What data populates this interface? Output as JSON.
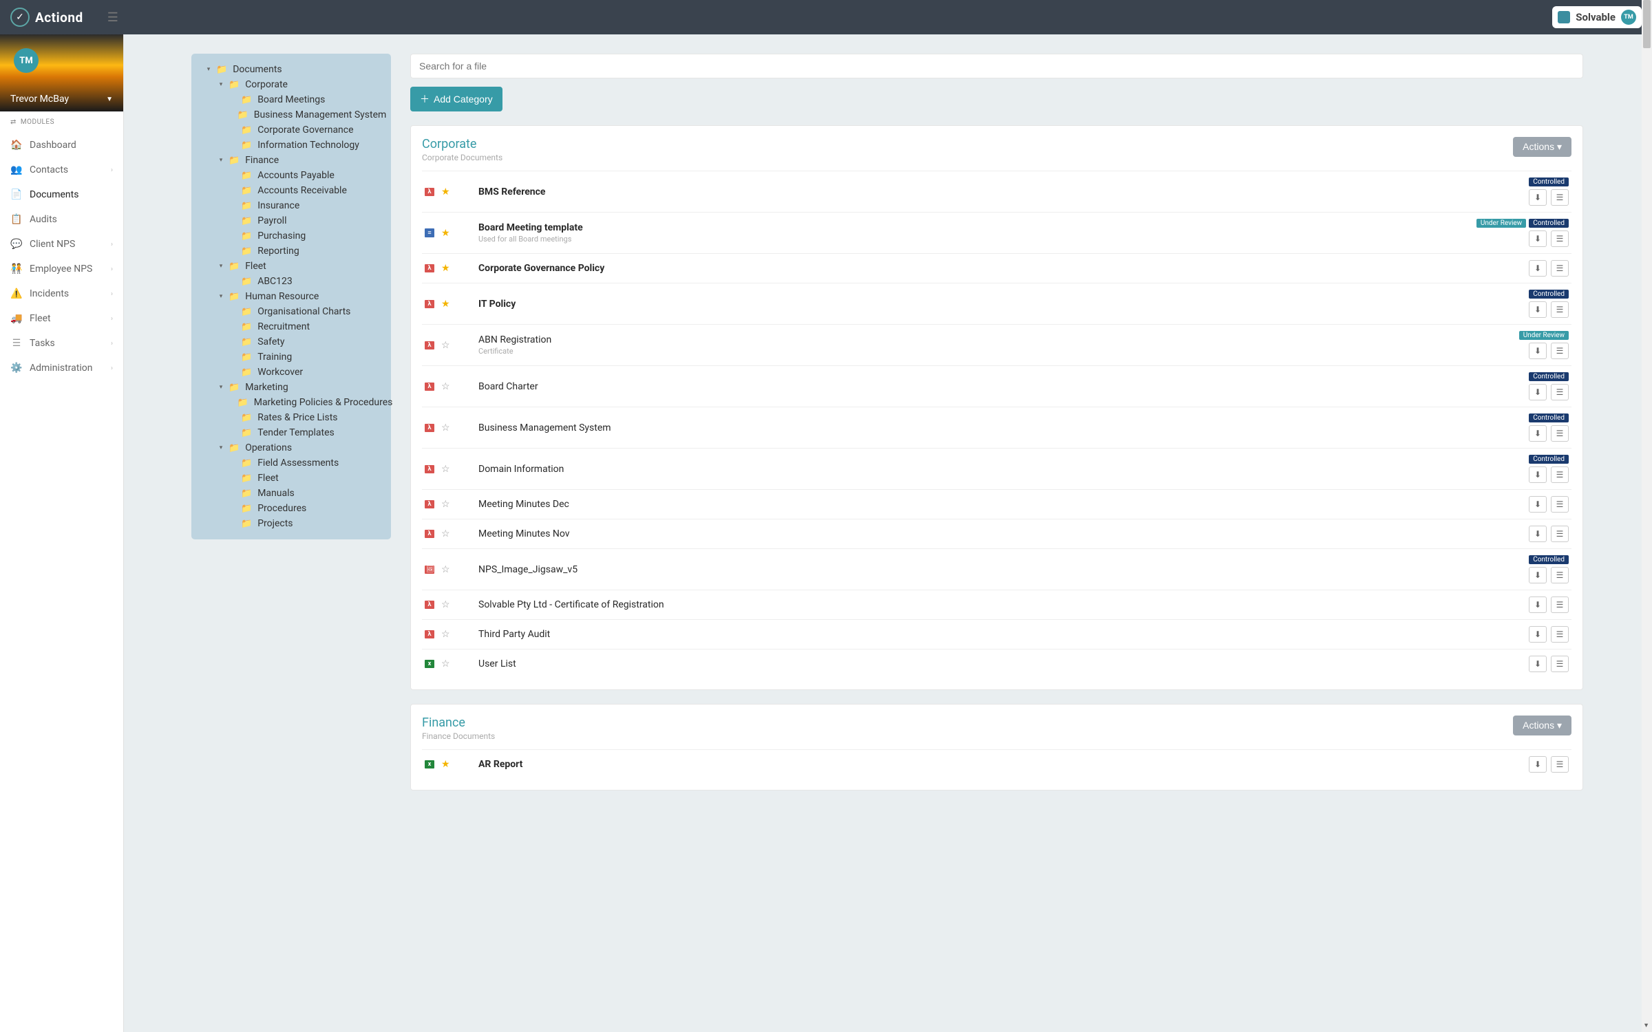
{
  "brand": {
    "name": "Actiond",
    "pill_text": "Solvable",
    "pill_avatar": "TM"
  },
  "user": {
    "initials": "TM",
    "name": "Trevor McBay"
  },
  "sidebar": {
    "modules_label": "MODULES",
    "items": [
      {
        "label": "Dashboard",
        "expandable": false
      },
      {
        "label": "Contacts",
        "expandable": true
      },
      {
        "label": "Documents",
        "expandable": false,
        "active": true
      },
      {
        "label": "Audits",
        "expandable": false
      },
      {
        "label": "Client NPS",
        "expandable": true
      },
      {
        "label": "Employee NPS",
        "expandable": true
      },
      {
        "label": "Incidents",
        "expandable": true
      },
      {
        "label": "Fleet",
        "expandable": true
      },
      {
        "label": "Tasks",
        "expandable": true
      },
      {
        "label": "Administration",
        "expandable": true
      }
    ]
  },
  "tree": {
    "root": "Documents",
    "nodes": [
      {
        "label": "Corporate",
        "children": [
          "Board Meetings",
          "Business Management System",
          "Corporate Governance",
          "Information Technology"
        ]
      },
      {
        "label": "Finance",
        "children": [
          "Accounts Payable",
          "Accounts Receivable",
          "Insurance",
          "Payroll",
          "Purchasing",
          "Reporting"
        ]
      },
      {
        "label": "Fleet",
        "children": [
          "ABC123"
        ]
      },
      {
        "label": "Human Resource",
        "children": [
          "Organisational Charts",
          "Recruitment",
          "Safety",
          "Training",
          "Workcover"
        ]
      },
      {
        "label": "Marketing",
        "children": [
          "Marketing Policies & Procedures",
          "Rates & Price Lists",
          "Tender Templates"
        ]
      },
      {
        "label": "Operations",
        "children": [
          "Field Assessments",
          "Fleet",
          "Manuals",
          "Procedures",
          "Projects"
        ]
      }
    ]
  },
  "search": {
    "placeholder": "Search for a file"
  },
  "buttons": {
    "add_category": "Add Category",
    "actions": "Actions"
  },
  "badges": {
    "controlled": "Controlled",
    "under_review": "Under Review"
  },
  "categories": [
    {
      "title": "Corporate",
      "subtitle": "Corporate Documents",
      "files": [
        {
          "name": "BMS Reference",
          "type": "pdf",
          "starred": true,
          "bold": true,
          "badges": [
            "controlled"
          ]
        },
        {
          "name": "Board Meeting template",
          "type": "doc",
          "starred": true,
          "bold": true,
          "desc": "Used for all Board meetings",
          "badges": [
            "under_review",
            "controlled"
          ]
        },
        {
          "name": "Corporate Governance Policy",
          "type": "pdf",
          "starred": true,
          "bold": true,
          "badges": []
        },
        {
          "name": "IT Policy",
          "type": "pdf",
          "starred": true,
          "bold": true,
          "badges": [
            "controlled"
          ]
        },
        {
          "name": "ABN Registration",
          "type": "pdf",
          "starred": false,
          "bold": false,
          "desc": "Certificate",
          "badges": [
            "under_review"
          ]
        },
        {
          "name": "Board Charter",
          "type": "pdf",
          "starred": false,
          "bold": false,
          "badges": [
            "controlled"
          ]
        },
        {
          "name": "Business Management System",
          "type": "pdf",
          "starred": false,
          "bold": false,
          "badges": [
            "controlled"
          ]
        },
        {
          "name": "Domain Information",
          "type": "pdf",
          "starred": false,
          "bold": false,
          "badges": [
            "controlled"
          ]
        },
        {
          "name": "Meeting Minutes Dec",
          "type": "pdf",
          "starred": false,
          "bold": false,
          "badges": []
        },
        {
          "name": "Meeting Minutes Nov",
          "type": "pdf",
          "starred": false,
          "bold": false,
          "badges": []
        },
        {
          "name": "NPS_Image_Jigsaw_v5",
          "type": "img",
          "starred": false,
          "bold": false,
          "badges": [
            "controlled"
          ]
        },
        {
          "name": "Solvable Pty Ltd - Certificate of Registration",
          "type": "pdf",
          "starred": false,
          "bold": false,
          "badges": []
        },
        {
          "name": "Third Party Audit",
          "type": "pdf",
          "starred": false,
          "bold": false,
          "badges": []
        },
        {
          "name": "User List",
          "type": "xls",
          "starred": false,
          "bold": false,
          "badges": []
        }
      ]
    },
    {
      "title": "Finance",
      "subtitle": "Finance Documents",
      "files": [
        {
          "name": "AR Report",
          "type": "xls",
          "starred": true,
          "bold": true,
          "badges": []
        }
      ]
    }
  ]
}
